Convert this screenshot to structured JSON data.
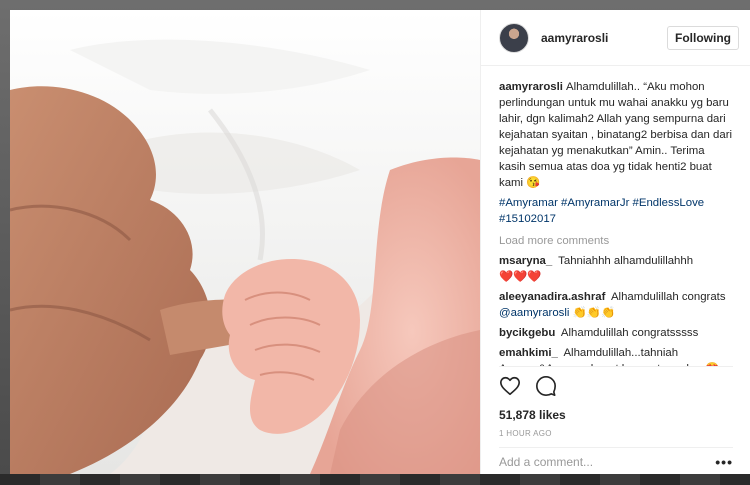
{
  "post": {
    "username": "aamyrarosli",
    "follow_label": "Following",
    "caption_user": "aamyrarosli",
    "caption_text": "Alhamdulillah.. “Aku mohon perlindungan untuk mu wahai anakku yg baru lahir, dgn kalimah2 Allah yang sempurna dari kejahatan syaitan , binatang2 berbisa dan dari kejahatan yg menakutkan” Amin.. Terima kasih semua atas doa yg tidak henti2 buat kami 😘",
    "hashtags": "#Amyramar #AmyramarJr #EndlessLove #15102017",
    "load_more": "Load more comments",
    "likes": "51,878 likes",
    "time": "1 HOUR AGO",
    "comment_placeholder": "Add a comment...",
    "more_icon": "more-options-icon"
  },
  "comments": [
    {
      "user": "msaryna_",
      "text": "Tahniahhh alhamdulillahhh",
      "emoji": "❤️❤️❤️"
    },
    {
      "user": "aleeyanadira.ashraf",
      "text": "Alhamdulillah congrats",
      "mention": "@aamyrarosli",
      "emoji": "👏👏👏"
    },
    {
      "user": "bycikgebu",
      "text": "Alhamdulillah congratsssss"
    },
    {
      "user": "emahkimi_",
      "text": "Alhamdulillah...tahniah Aamyra&Amar, selamat berpantang dear",
      "emoji": "😍"
    }
  ],
  "icons": {
    "like": "heart-icon",
    "comment": "comment-bubble-icon"
  },
  "colors": {
    "link": "#003569",
    "muted": "#999999",
    "border": "#efefef"
  }
}
